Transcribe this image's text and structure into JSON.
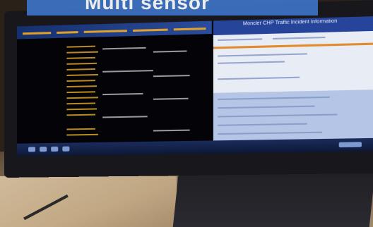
{
  "caption": {
    "text": "Multi sensor"
  },
  "right_pane": {
    "title": "Moncler CHP Traffic Incident Information"
  }
}
